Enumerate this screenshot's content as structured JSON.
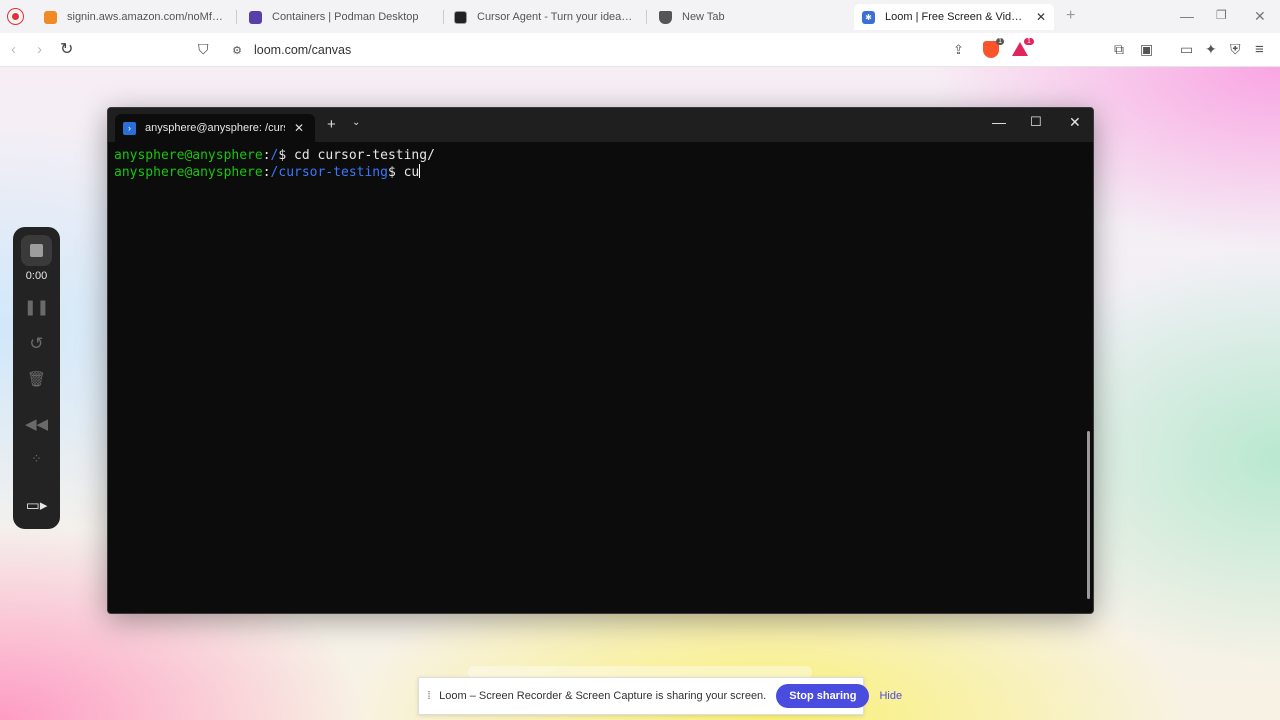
{
  "browser": {
    "tabs": [
      {
        "title": "signin.aws.amazon.com/noMfa?actio",
        "icon": "aws-cube-icon",
        "color": "#f08a24",
        "active": false
      },
      {
        "title": "Containers | Podman Desktop",
        "icon": "podman-icon",
        "color": "#5b3fa8",
        "active": false
      },
      {
        "title": "Cursor Agent - Turn your ideas into c",
        "icon": "cursor-icon",
        "color": "#222222",
        "active": false
      },
      {
        "title": "New Tab",
        "icon": "brave-shield-icon",
        "color": "#555555",
        "active": false
      },
      {
        "title": "Loom | Free Screen & Video Rec",
        "icon": "loom-icon",
        "color": "#3b6fd8",
        "active": true
      }
    ],
    "url": "loom.com/canvas",
    "shield_badge": "1",
    "rewards_badge": "1"
  },
  "terminal": {
    "tab_title": "anysphere@anysphere: /curso",
    "lines": [
      {
        "user": "anysphere@anysphere",
        "sep": ":",
        "path": "/",
        "prompt": "$ ",
        "cmd": "cd cursor-testing/"
      },
      {
        "user": "anysphere@anysphere",
        "sep": ":",
        "path": "/cursor-testing",
        "prompt": "$ ",
        "cmd": "cu"
      }
    ]
  },
  "recorder": {
    "time": "0:00"
  },
  "share_banner": {
    "message": "Loom – Screen Recorder & Screen Capture is sharing your screen.",
    "stop_label": "Stop sharing",
    "hide_label": "Hide"
  },
  "colors": {
    "accent": "#4a4ce0",
    "term_user": "#16c60c",
    "term_path": "#3b78ff"
  }
}
